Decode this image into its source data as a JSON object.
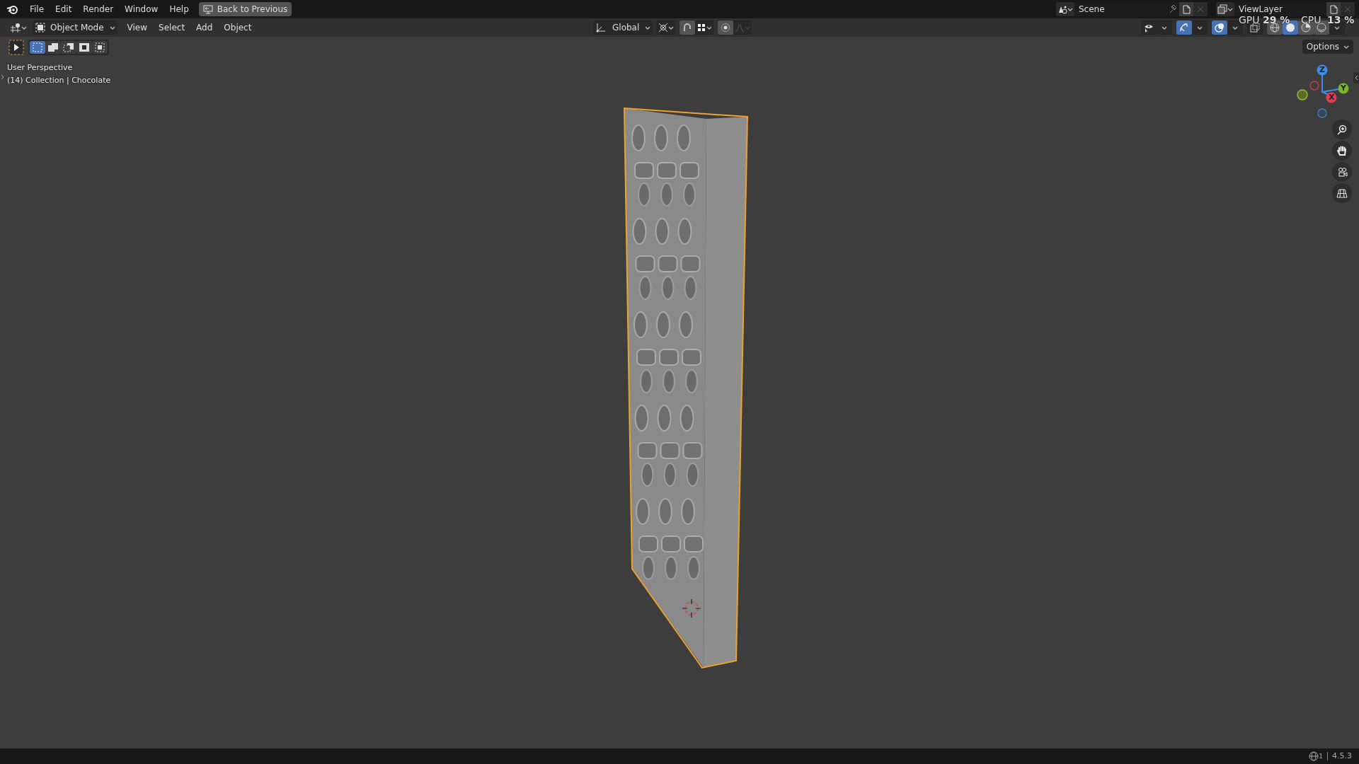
{
  "top_menu": {
    "items": [
      "File",
      "Edit",
      "Render",
      "Window",
      "Help"
    ],
    "back_button": "Back to Previous"
  },
  "scene": {
    "name": "Scene"
  },
  "view_layer": {
    "name": "ViewLayer"
  },
  "header": {
    "mode": "Object Mode",
    "menus": [
      "View",
      "Select",
      "Add",
      "Object"
    ],
    "orientation": "Global",
    "snap_on": false,
    "gizmos_on": true,
    "overlays_on": true,
    "xray_on": false
  },
  "select_modes": [
    {
      "selected": true
    },
    {
      "selected": false
    },
    {
      "selected": false
    },
    {
      "selected": false
    },
    {
      "selected": false
    }
  ],
  "shading_modes": [
    {
      "selected": false
    },
    {
      "selected": true
    },
    {
      "selected": false
    },
    {
      "selected": false
    }
  ],
  "stats": {
    "gpu_label": "GPU",
    "gpu_value": "29 %",
    "cpu_label": "CPU",
    "cpu_value": "13 %"
  },
  "viewport": {
    "view_name": "User Perspective",
    "object_info": "(14) Collection | Chocolate",
    "options": "Options"
  },
  "gizmo": {
    "axes": [
      "Z",
      "Y",
      "X"
    ]
  },
  "status_bar": {
    "scene_count": "1",
    "version": "4.5.3"
  }
}
